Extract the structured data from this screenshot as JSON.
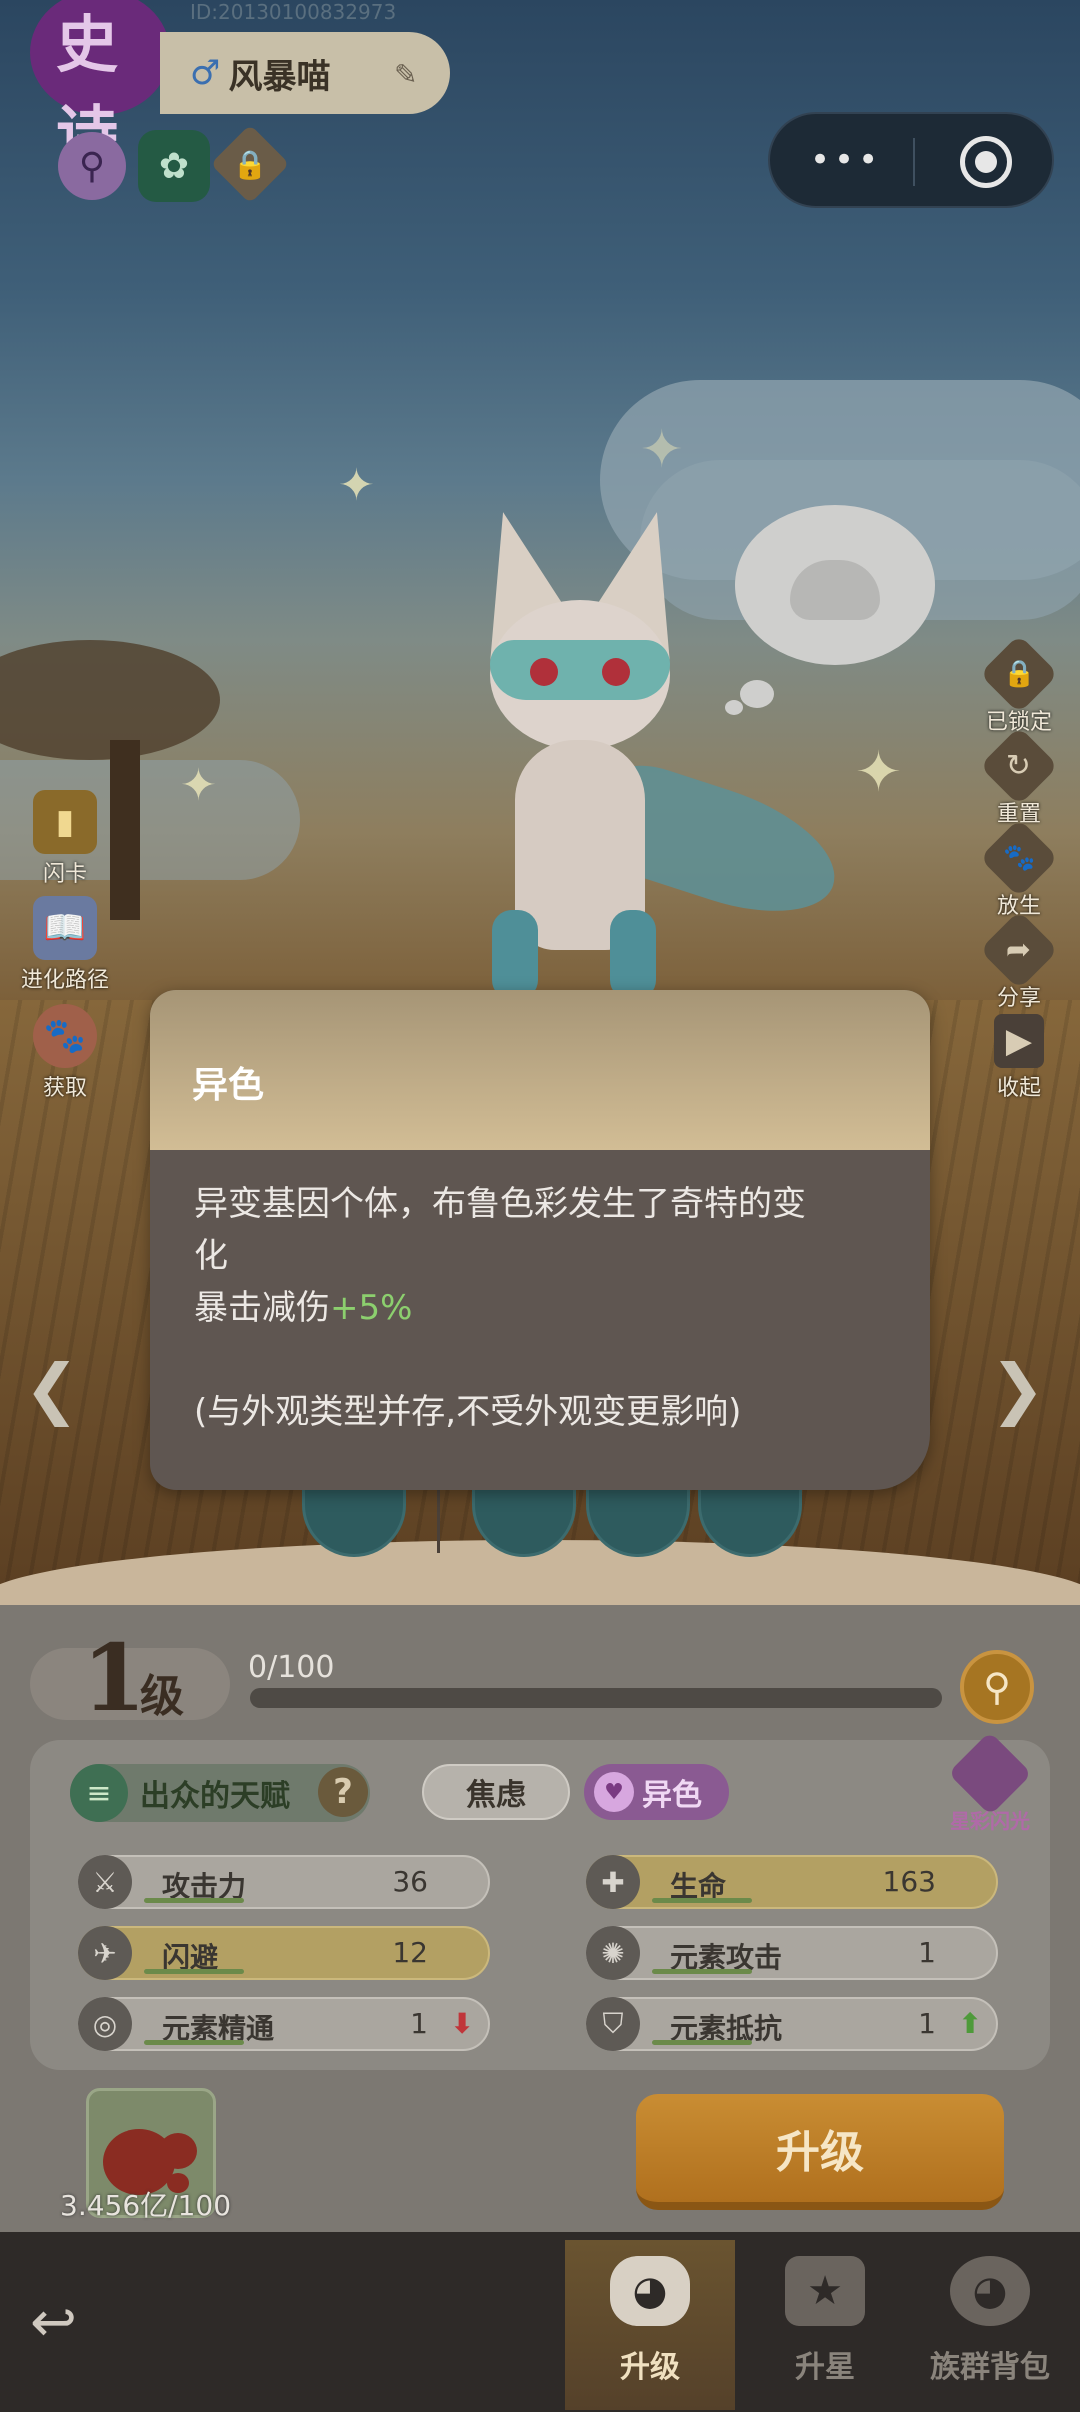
{
  "header": {
    "rarity": "史诗",
    "pet_id": "ID:20130100832973",
    "gender_symbol": "♂",
    "pet_name": "风暴喵"
  },
  "side_left": [
    {
      "label": "闪卡",
      "icon": "card-icon"
    },
    {
      "label": "进化路径",
      "icon": "book-icon"
    },
    {
      "label": "获取",
      "icon": "paw-icon"
    }
  ],
  "side_right": [
    {
      "label": "已锁定",
      "icon": "lock-icon"
    },
    {
      "label": "重置",
      "icon": "reset-icon"
    },
    {
      "label": "放生",
      "icon": "release-icon"
    },
    {
      "label": "分享",
      "icon": "share-icon"
    },
    {
      "label": "收起",
      "icon": "collapse-icon"
    }
  ],
  "tooltip": {
    "title": "异色",
    "line1": "异变基因个体，布鲁色彩发生了奇特的变",
    "line2": "化",
    "effect_label": "暴击减伤",
    "effect_value": "+5%",
    "note": "(与外观类型并存,不受外观变更影响)"
  },
  "level": {
    "number": "1",
    "unit": "级",
    "xp_text": "0/100",
    "xp_fraction": 0.0
  },
  "traits": {
    "talent": "出众的天赋",
    "help": "?",
    "nature": "焦虑",
    "variant": "异色",
    "shiny_label": "星彩闪光"
  },
  "stats": [
    {
      "label": "攻击力",
      "value": "36",
      "icon": "sword-icon",
      "highlight": false,
      "arrow": ""
    },
    {
      "label": "生命",
      "value": "163",
      "icon": "heart-plus-icon",
      "highlight": true,
      "arrow": ""
    },
    {
      "label": "闪避",
      "value": "12",
      "icon": "wing-icon",
      "highlight": true,
      "arrow": ""
    },
    {
      "label": "元素攻击",
      "value": "1",
      "icon": "element-icon",
      "highlight": false,
      "arrow": ""
    },
    {
      "label": "元素精通",
      "value": "1",
      "icon": "swirl-icon",
      "highlight": false,
      "arrow": "down"
    },
    {
      "label": "元素抵抗",
      "value": "1",
      "icon": "shield-icon",
      "highlight": false,
      "arrow": "up"
    }
  ],
  "item": {
    "count": "3.456亿/100"
  },
  "upgrade_button": "升级",
  "tabs": [
    {
      "label": "升级",
      "active": true
    },
    {
      "label": "升星",
      "active": false
    },
    {
      "label": "族群背包",
      "active": false
    }
  ],
  "colors": {
    "accent_gold": "#b0701e",
    "variant_purple": "#8a5a92",
    "effect_green": "#8ccf6e",
    "stat_down_red": "#c0353a",
    "stat_up_green": "#4e9a3a"
  }
}
